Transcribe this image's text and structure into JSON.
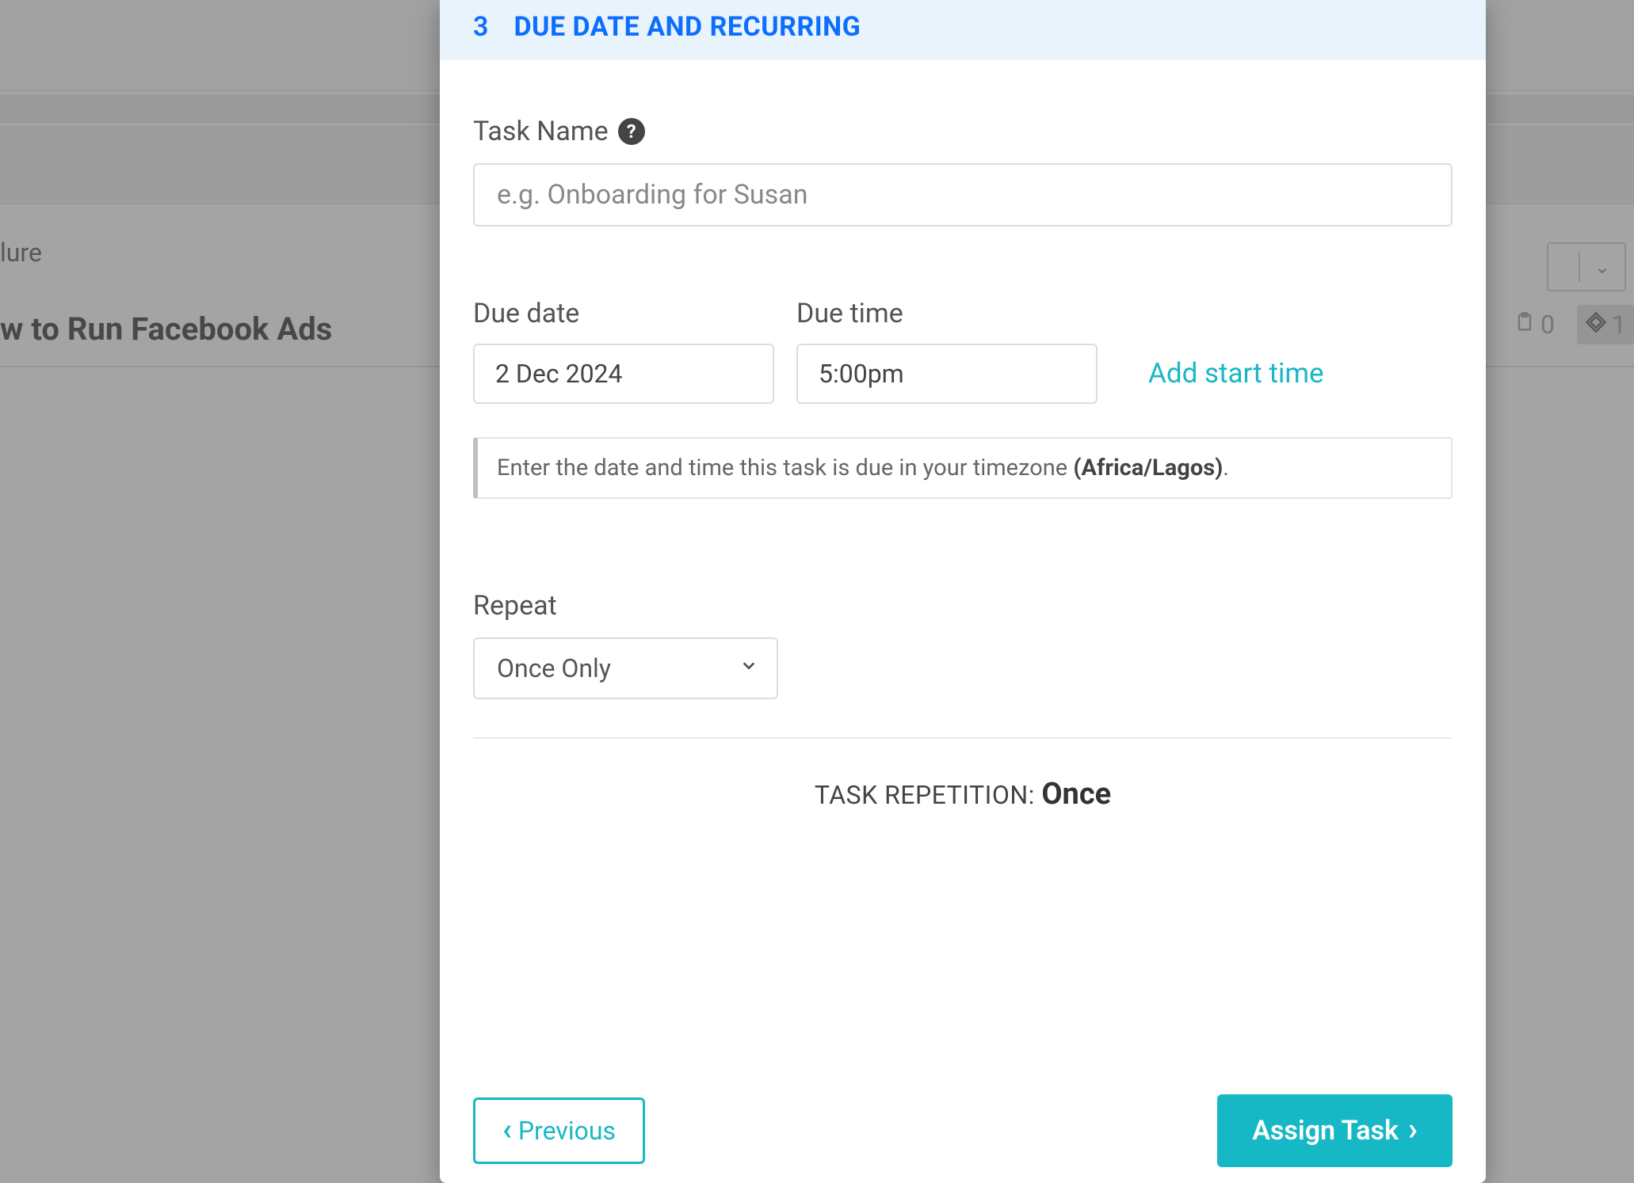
{
  "background": {
    "breadcrumb_fragment": "lure",
    "page_title_fragment": "w to Run Facebook Ads",
    "stat_count_1": "0",
    "stat_count_2": "1"
  },
  "step": {
    "number": "3",
    "title": "DUE DATE AND RECURRING"
  },
  "task_name": {
    "label": "Task Name",
    "placeholder": "e.g. Onboarding for Susan",
    "value": ""
  },
  "due_date": {
    "label": "Due date",
    "value": "2 Dec 2024"
  },
  "due_time": {
    "label": "Due time",
    "value": "5:00pm"
  },
  "add_start_time_label": "Add start time",
  "info_box": {
    "text_prefix": "Enter the date and time this task is due in your timezone ",
    "timezone": "(Africa/Lagos)",
    "text_suffix": "."
  },
  "repeat": {
    "label": "Repeat",
    "selected": "Once Only"
  },
  "repetition": {
    "label": "TASK REPETITION: ",
    "value": "Once"
  },
  "buttons": {
    "previous": "Previous",
    "assign": "Assign Task"
  }
}
